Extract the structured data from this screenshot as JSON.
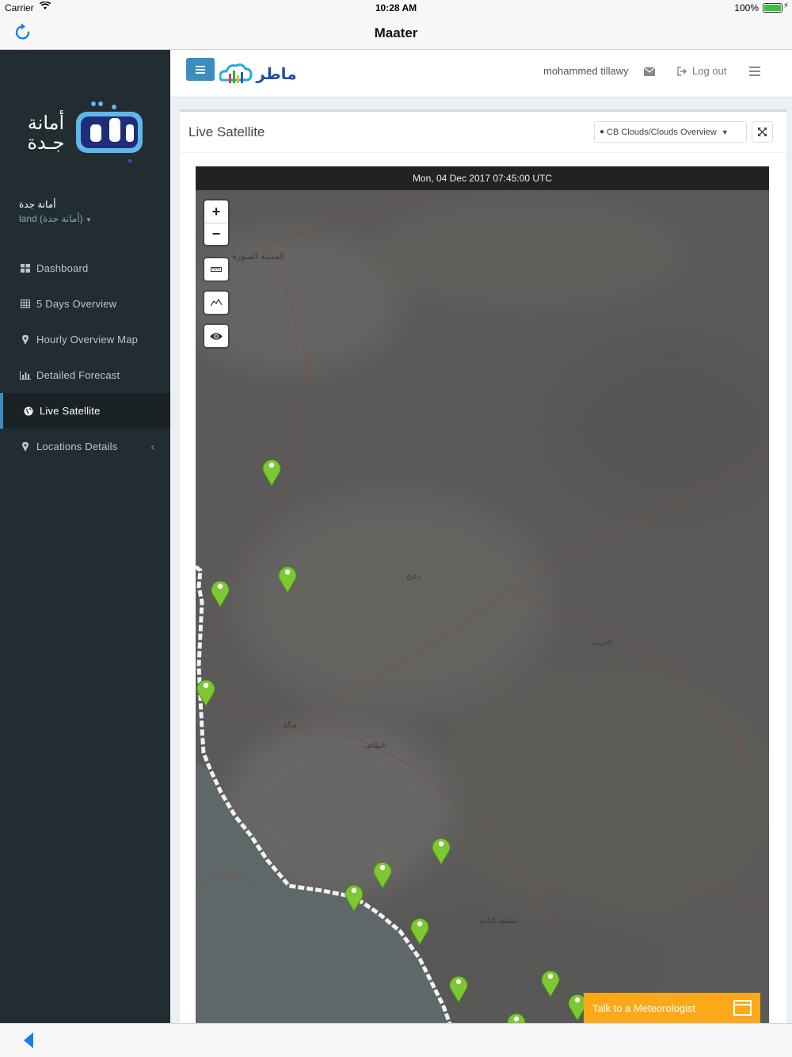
{
  "status_bar": {
    "carrier": "Carrier",
    "time": "10:28 AM",
    "battery": "100%"
  },
  "nav": {
    "title": "Maater"
  },
  "sidebar": {
    "logo_text": "أمانة جدة",
    "user_name": "أمانة جدة",
    "user_role": "land (أمانة جدة)",
    "items": [
      {
        "label": "Dashboard",
        "icon": "dashboard-icon"
      },
      {
        "label": "5 Days Overview",
        "icon": "table-icon"
      },
      {
        "label": "Hourly Overview Map",
        "icon": "map-marker-icon"
      },
      {
        "label": "Detailed Forecast",
        "icon": "bar-chart-icon"
      },
      {
        "label": "Live Satellite",
        "icon": "globe-icon",
        "active": true
      },
      {
        "label": "Locations Details",
        "icon": "map-marker-icon"
      }
    ]
  },
  "topbar": {
    "brand": "ماطر",
    "user": "mohammed tillawy",
    "logout": "Log out"
  },
  "panel": {
    "title": "Live Satellite",
    "layer_select": "CB Clouds/Clouds Overview"
  },
  "map": {
    "timestamp": "Mon, 04 Dec 2017 07:45:00 UTC",
    "labels": {
      "madinah": "المدينة المنورة",
      "dahah": "دعيج",
      "khurmah": "الخرمة",
      "makkah": "مكة",
      "taif": "الطائف",
      "baha": "منطقة الباحة"
    },
    "marker_color": "#7dc832"
  },
  "cta": {
    "label": "Talk to a Meteorologist",
    "color": "#fba919"
  }
}
